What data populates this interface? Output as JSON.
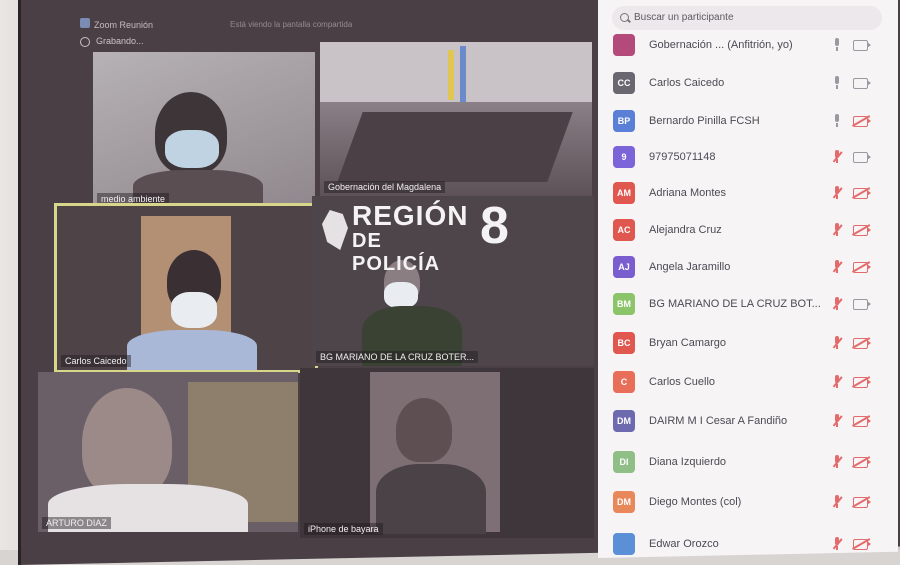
{
  "window": {
    "title": "Zoom Reunión",
    "info": "Está viendo la pantalla compartida",
    "recording": "Grabando..."
  },
  "tiles": [
    {
      "name": "medio ambiente"
    },
    {
      "name": "Gobernación del Magdalena"
    },
    {
      "name": "Carlos Caicedo"
    },
    {
      "name": "BG MARIANO DE LA CRUZ BOTER..."
    },
    {
      "name": "ARTURO DIAZ"
    },
    {
      "name": "iPhone de bayara"
    }
  ],
  "brand": {
    "line1": "REGIÓN",
    "line2": "DE POLICÍA",
    "number": "8"
  },
  "search": {
    "placeholder": "Buscar un participante"
  },
  "participants": [
    {
      "initials": "",
      "name": "Gobernación ... (Anfitrión, yo)",
      "color": "#b34a7a",
      "mic": "on",
      "cam": "on"
    },
    {
      "initials": "CC",
      "name": "Carlos Caicedo",
      "color": "#6a6770",
      "mic": "on",
      "cam": "on"
    },
    {
      "initials": "BP",
      "name": "Bernardo Pinilla FCSH",
      "color": "#5a7fd6",
      "mic": "on",
      "cam": "off"
    },
    {
      "initials": "9",
      "name": "97975071148",
      "color": "#7a64d8",
      "mic": "off",
      "cam": "on"
    },
    {
      "initials": "AM",
      "name": "Adriana Montes",
      "color": "#e0574f",
      "mic": "off",
      "cam": "off"
    },
    {
      "initials": "AC",
      "name": "Alejandra Cruz",
      "color": "#e0574f",
      "mic": "off",
      "cam": "off"
    },
    {
      "initials": "AJ",
      "name": "Angela Jaramillo",
      "color": "#7a5ed0",
      "mic": "off",
      "cam": "off"
    },
    {
      "initials": "BM",
      "name": "BG MARIANO DE LA CRUZ BOT...",
      "color": "#8cc46a",
      "mic": "off",
      "cam": "on"
    },
    {
      "initials": "BC",
      "name": "Bryan Camargo",
      "color": "#e0574f",
      "mic": "off",
      "cam": "off"
    },
    {
      "initials": "C",
      "name": "Carlos Cuello",
      "color": "#e86e5a",
      "mic": "off",
      "cam": "off"
    },
    {
      "initials": "DM",
      "name": "DAIRM M I Cesar A Fandiño",
      "color": "#6d6ab0",
      "mic": "off",
      "cam": "off"
    },
    {
      "initials": "DI",
      "name": "Diana Izquierdo",
      "color": "#8fbf86",
      "mic": "off",
      "cam": "off"
    },
    {
      "initials": "DM",
      "name": "Diego Montes (col)",
      "color": "#e8885a",
      "mic": "off",
      "cam": "off"
    },
    {
      "initials": "",
      "name": "Edwar Orozco",
      "color": "#5b8fd6",
      "mic": "off",
      "cam": "off"
    }
  ]
}
